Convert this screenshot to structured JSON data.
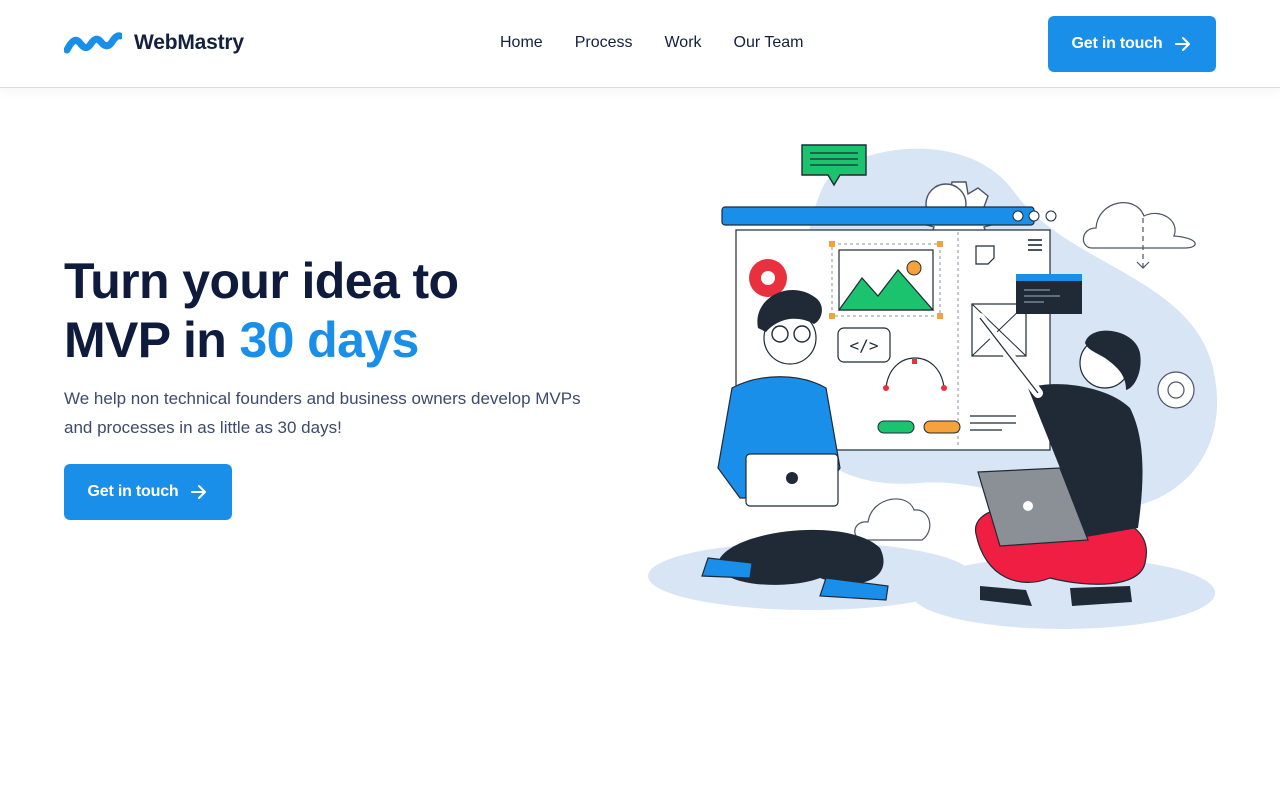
{
  "brand": {
    "name": "WebMastry",
    "logo_icon": "wave-logo-icon",
    "primary_color": "#1a8fe9",
    "dark_color": "#0f1b3d"
  },
  "nav": {
    "links": [
      "Home",
      "Process",
      "Work",
      "Our Team"
    ],
    "cta_label": "Get in touch",
    "cta_icon": "arrow-right-icon"
  },
  "hero": {
    "title_line1": "Turn your idea to",
    "title_line2_prefix": "MVP in ",
    "title_line2_accent": "30 days",
    "subtitle": "We help non technical founders and business owners develop MVPs and processes in as little as 30 days!",
    "cta_label": "Get in touch",
    "cta_icon": "arrow-right-icon",
    "illustration": "developers-building-mvp-illustration"
  }
}
